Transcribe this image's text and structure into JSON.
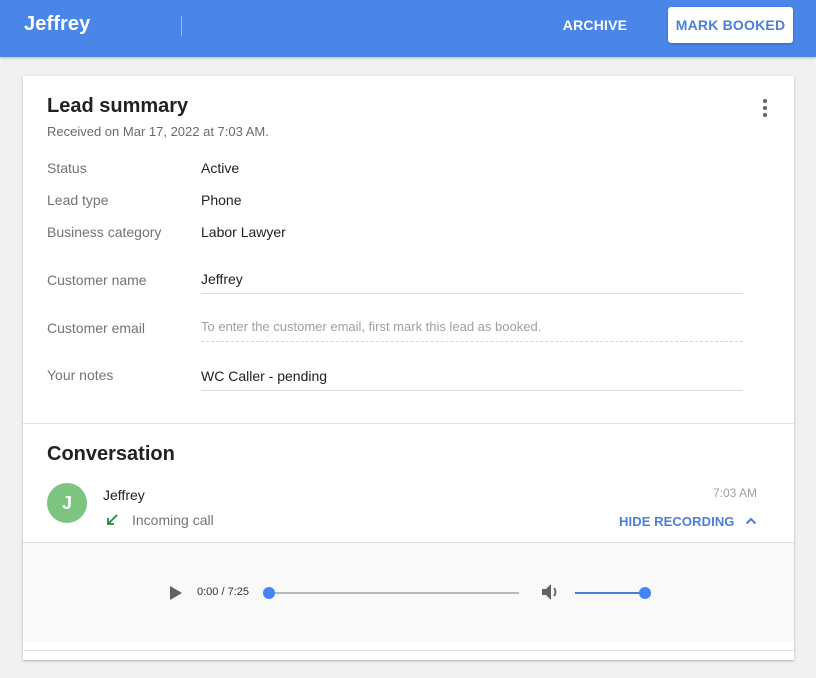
{
  "header": {
    "title": "Jeffrey",
    "archive_label": "ARCHIVE",
    "mark_booked_label": "MARK BOOKED"
  },
  "lead_summary": {
    "title": "Lead summary",
    "received": "Received on Mar 17, 2022 at 7:03 AM.",
    "more_icon": "more-vert-icon",
    "rows": [
      {
        "label": "Status",
        "value": "Active"
      },
      {
        "label": "Lead type",
        "value": "Phone"
      },
      {
        "label": "Business category",
        "value": "Labor Lawyer"
      }
    ],
    "fields": {
      "customer_name": {
        "label": "Customer name",
        "value": "Jeffrey"
      },
      "customer_email": {
        "label": "Customer email",
        "placeholder": "To enter the customer email, first mark this lead as booked."
      },
      "notes": {
        "label": "Your notes",
        "value": "WC Caller - pending"
      }
    }
  },
  "conversation": {
    "title": "Conversation",
    "avatar_initial": "J",
    "caller": "Jeffrey",
    "call_type": "Incoming call",
    "call_type_icon": "call-received-icon",
    "time": "7:03 AM",
    "hide_recording_label": "HIDE RECORDING",
    "player": {
      "time_readout": "0:00 / 7:25",
      "progress_fraction": 0.0,
      "volume_fraction": 1.0
    }
  },
  "colors": {
    "brand": "#4a86e8",
    "accent": "#4285f4",
    "avatar": "#7cc47f",
    "incoming_icon": "#1e8e3e"
  }
}
